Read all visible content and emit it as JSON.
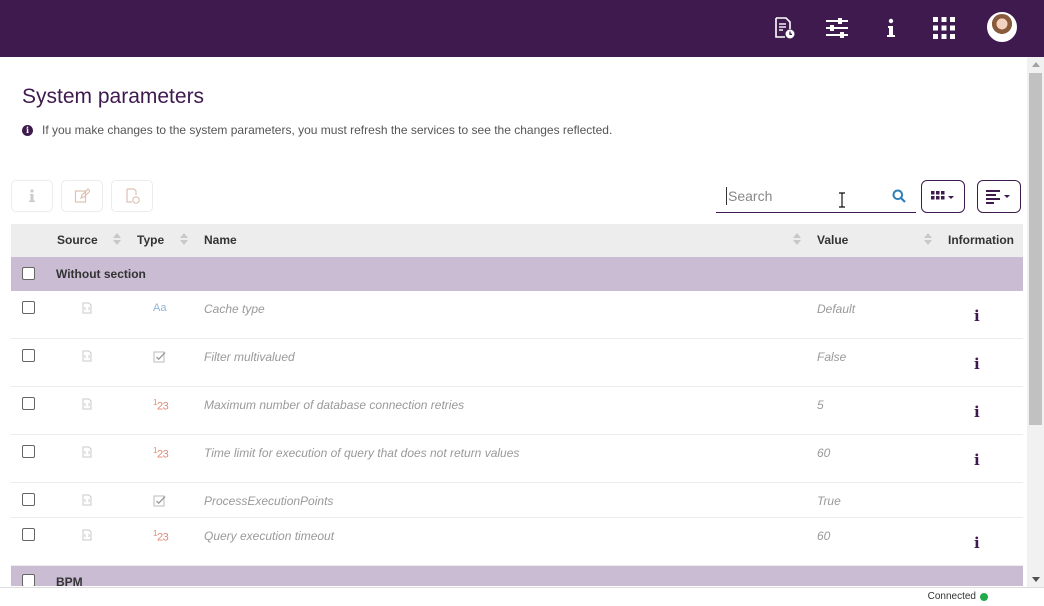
{
  "header": {
    "icons": [
      "report-clock-icon",
      "sliders-icon",
      "info-icon",
      "apps-grid-icon"
    ],
    "avatar": "user-avatar"
  },
  "page": {
    "title": "System parameters",
    "info_text": "If you make changes to the system parameters, you must refresh the services to see the changes reflected."
  },
  "toolbar": {
    "search_placeholder": "Search",
    "buttons": [
      "info-icon",
      "edit-icon",
      "history-icon"
    ]
  },
  "table": {
    "columns": [
      "Source",
      "Type",
      "Name",
      "Value",
      "Information"
    ],
    "sections": [
      {
        "title": "Without section",
        "rows": [
          {
            "type_icon": "Aa",
            "name": "Cache type",
            "value": "Default",
            "info": true
          },
          {
            "type_icon": "check",
            "name": "Filter multivalued",
            "value": "False",
            "info": true
          },
          {
            "type_icon": "123",
            "name": "Maximum number of database connection retries",
            "value": "5",
            "info": true
          },
          {
            "type_icon": "123",
            "name": "Time limit for execution of query that does not return values",
            "value": "60",
            "info": true
          },
          {
            "type_icon": "check",
            "name": "ProcessExecutionPoints",
            "value": "True",
            "info": false
          },
          {
            "type_icon": "123",
            "name": "Query execution timeout",
            "value": "60",
            "info": true
          }
        ]
      },
      {
        "title": "BPM",
        "rows": []
      }
    ]
  },
  "status": {
    "label": "Connected",
    "color": "#22a94a"
  },
  "colors": {
    "brand": "#3e1a4e",
    "section_bg": "#c9bcd3"
  }
}
